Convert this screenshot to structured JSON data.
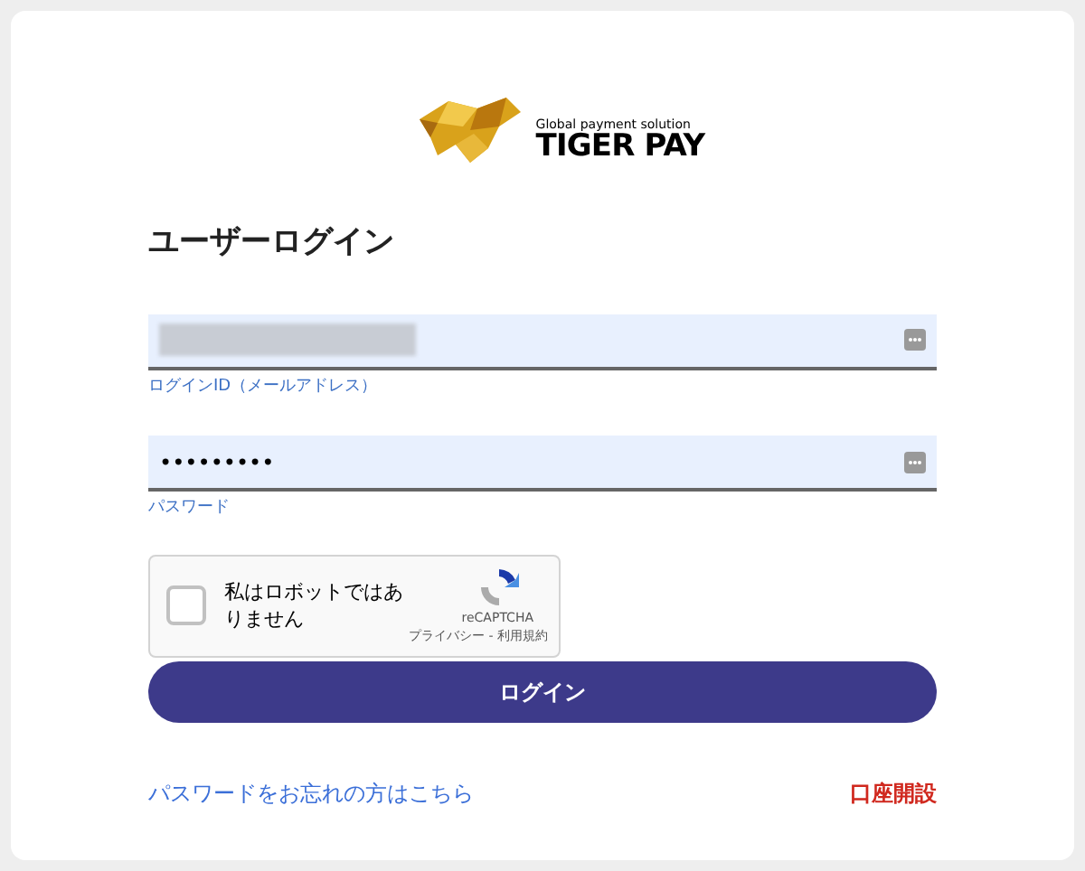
{
  "logo": {
    "tagline": "Global payment solution",
    "name": "TIGER PAY"
  },
  "heading": "ユーザーログイン",
  "fields": [
    {
      "kind": "obscured",
      "label": "ログインID（メールアドレス）"
    },
    {
      "kind": "password",
      "value": "•••••••••",
      "label": "パスワード"
    }
  ],
  "captcha": {
    "checked": false,
    "text": "私はロボットではありません",
    "brand": "reCAPTCHA",
    "links": "プライバシー - 利用規約"
  },
  "login_button": "ログイン",
  "forgot_link": "パスワードをお忘れの方はこちら",
  "signup_link": "口座開設"
}
